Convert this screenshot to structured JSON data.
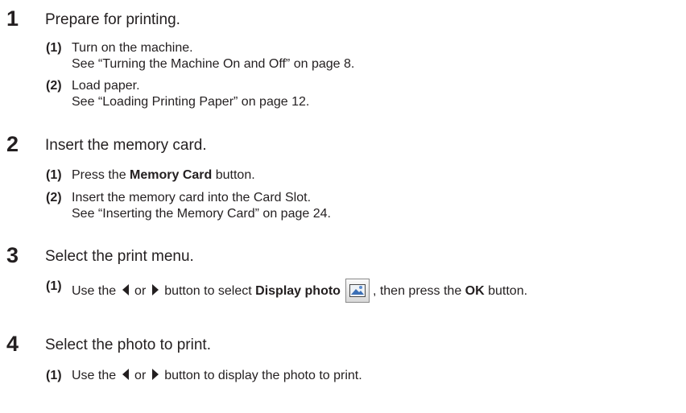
{
  "steps": [
    {
      "number": "1",
      "title": "Prepare for printing.",
      "items": [
        {
          "n": "(1)",
          "text": "Turn on the machine.",
          "ref": "See “Turning the Machine On and Off” on page 8."
        },
        {
          "n": "(2)",
          "text": "Load paper.",
          "ref": "See “Loading Printing Paper” on page 12."
        }
      ]
    },
    {
      "number": "2",
      "title": "Insert the memory card.",
      "items": [
        {
          "n": "(1)",
          "pre": "Press the ",
          "bold": "Memory Card",
          "post": " button."
        },
        {
          "n": "(2)",
          "text": "Insert the memory card into the Card Slot.",
          "ref": "See “Inserting the Memory Card” on page 24."
        }
      ]
    },
    {
      "number": "3",
      "title": "Select the print menu.",
      "items": [
        {
          "n": "(1)",
          "pre": "Use the",
          "or": "or",
          "mid": "button to select ",
          "bold": "Display photo",
          "post2": ", then press the ",
          "bold2": "OK",
          "post3": " button.",
          "icon": "display-photo-icon"
        }
      ]
    },
    {
      "number": "4",
      "title": "Select the photo to print.",
      "items": [
        {
          "n": "(1)",
          "pre": "Use the",
          "or": "or",
          "mid": "button to display the photo to print."
        }
      ]
    }
  ],
  "icons": {
    "left": "left-arrow-icon",
    "right": "right-arrow-icon"
  }
}
